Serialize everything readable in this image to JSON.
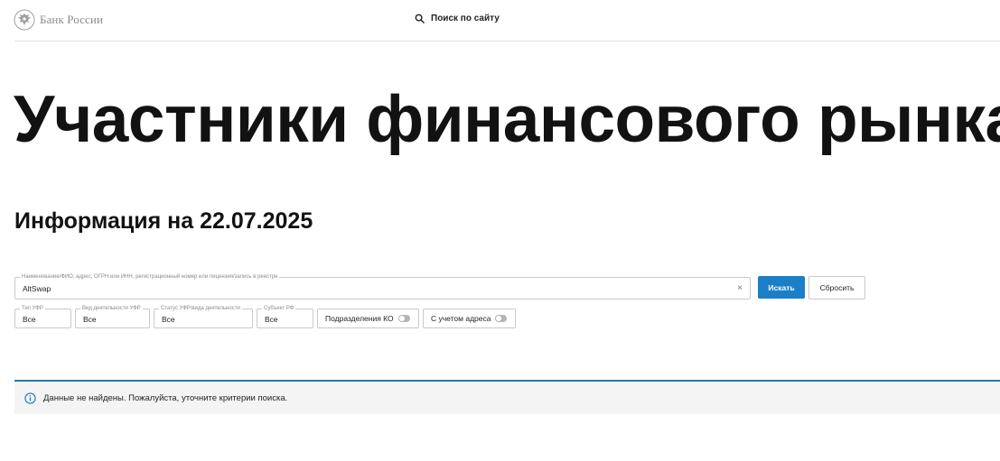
{
  "header": {
    "logo_text": "Банк России",
    "search_label": "Поиск по сайту"
  },
  "page": {
    "title": "Участники финансового рынка",
    "subtitle": "Информация на 22.07.2025"
  },
  "search": {
    "legend": "Наименование/ФИО, адрес, ОГРН или ИНН, регистрационный номер или лицензия/запись в реестре",
    "value": "AltSwap",
    "clear_symbol": "×",
    "search_button": "Искать",
    "reset_button": "Сбросить"
  },
  "filters": [
    {
      "legend": "Тип УФР",
      "value": "Все"
    },
    {
      "legend": "Вид деятельности УФР",
      "value": "Все"
    },
    {
      "legend": "Статус УФР/вида деятельности",
      "value": "Все"
    },
    {
      "legend": "Субъект РФ",
      "value": "Все"
    }
  ],
  "toggles": [
    {
      "label": "Подразделения КО",
      "on": false
    },
    {
      "label": "С учетом адреса",
      "on": false
    }
  ],
  "notice": {
    "text": "Данные не найдены. Пожалуйста, уточните критерии поиска."
  },
  "colors": {
    "accent_button": "#1a7fc7",
    "notice_border": "#1a7fa3",
    "notice_background": "#f4f4f4"
  },
  "icons": {
    "logo": "double-headed-eagle-icon",
    "search": "search-icon",
    "clear": "close-icon",
    "notice": "info-icon"
  }
}
